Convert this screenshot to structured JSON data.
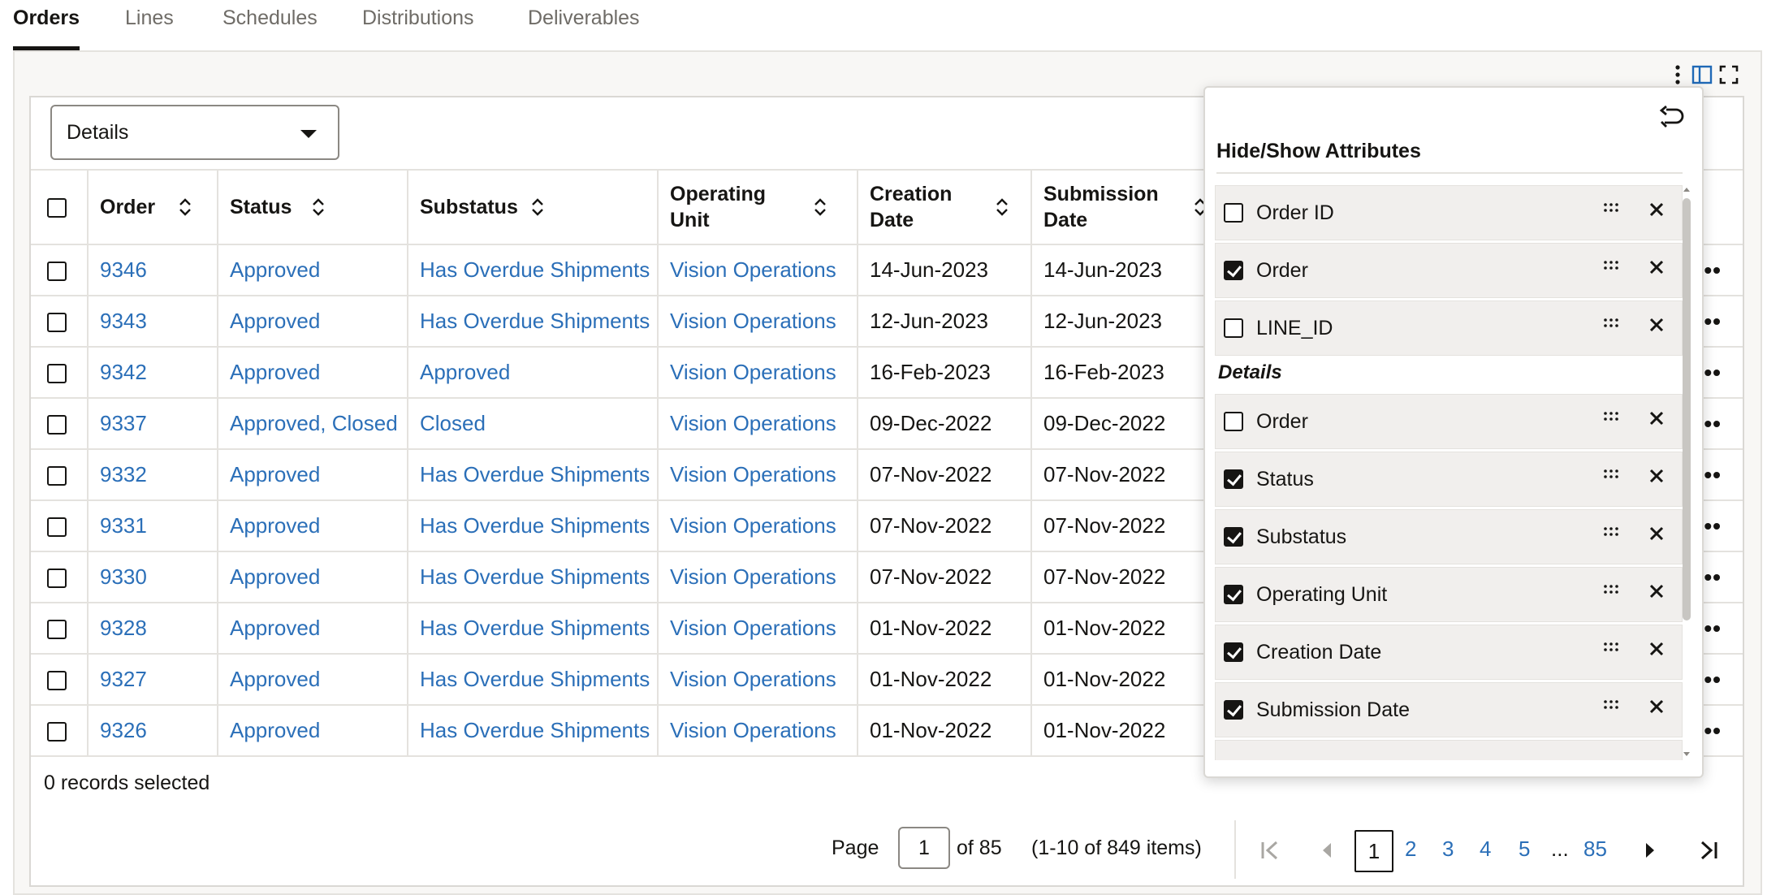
{
  "tabs": [
    {
      "label": "Orders",
      "active": true
    },
    {
      "label": "Lines",
      "active": false
    },
    {
      "label": "Schedules",
      "active": false
    },
    {
      "label": "Distributions",
      "active": false
    },
    {
      "label": "Deliverables",
      "active": false
    }
  ],
  "toolbar": {
    "icons": [
      "more-vertical-icon",
      "panel-toggle-icon",
      "fullscreen-icon"
    ]
  },
  "view_select": {
    "value": "Details"
  },
  "table": {
    "columns": [
      "Order",
      "Status",
      "Substatus",
      "Operating Unit",
      "Creation Date",
      "Submission Date"
    ],
    "rows": [
      {
        "order": "9346",
        "status": "Approved",
        "substatus": "Has Overdue Shipments",
        "unit": "Vision Operations",
        "created": "14-Jun-2023",
        "submitted": "14-Jun-2023"
      },
      {
        "order": "9343",
        "status": "Approved",
        "substatus": "Has Overdue Shipments",
        "unit": "Vision Operations",
        "created": "12-Jun-2023",
        "submitted": "12-Jun-2023"
      },
      {
        "order": "9342",
        "status": "Approved",
        "substatus": "Approved",
        "unit": "Vision Operations",
        "created": "16-Feb-2023",
        "submitted": "16-Feb-2023"
      },
      {
        "order": "9337",
        "status": "Approved, Closed",
        "substatus": "Closed",
        "unit": "Vision Operations",
        "created": "09-Dec-2022",
        "submitted": "09-Dec-2022"
      },
      {
        "order": "9332",
        "status": "Approved",
        "substatus": "Has Overdue Shipments",
        "unit": "Vision Operations",
        "created": "07-Nov-2022",
        "submitted": "07-Nov-2022"
      },
      {
        "order": "9331",
        "status": "Approved",
        "substatus": "Has Overdue Shipments",
        "unit": "Vision Operations",
        "created": "07-Nov-2022",
        "submitted": "07-Nov-2022"
      },
      {
        "order": "9330",
        "status": "Approved",
        "substatus": "Has Overdue Shipments",
        "unit": "Vision Operations",
        "created": "07-Nov-2022",
        "submitted": "07-Nov-2022"
      },
      {
        "order": "9328",
        "status": "Approved",
        "substatus": "Has Overdue Shipments",
        "unit": "Vision Operations",
        "created": "01-Nov-2022",
        "submitted": "01-Nov-2022"
      },
      {
        "order": "9327",
        "status": "Approved",
        "substatus": "Has Overdue Shipments",
        "unit": "Vision Operations",
        "created": "01-Nov-2022",
        "submitted": "01-Nov-2022"
      },
      {
        "order": "9326",
        "status": "Approved",
        "substatus": "Has Overdue Shipments",
        "unit": "Vision Operations",
        "created": "01-Nov-2022",
        "submitted": "01-Nov-2022"
      }
    ]
  },
  "footer": {
    "selected_text": "0 records selected",
    "page_label": "Page",
    "page_value": "1",
    "of_label": "of 85",
    "range_label": "(1-10 of 849 items)",
    "pages": [
      "1",
      "2",
      "3",
      "4",
      "5",
      "...",
      "85"
    ]
  },
  "attributes_popup": {
    "title": "Hide/Show Attributes",
    "section_label": "Details",
    "top_items": [
      {
        "label": "Order ID",
        "checked": false
      },
      {
        "label": "Order",
        "checked": true
      },
      {
        "label": "LINE_ID",
        "checked": false
      }
    ],
    "detail_items": [
      {
        "label": "Order",
        "checked": false
      },
      {
        "label": "Status",
        "checked": true
      },
      {
        "label": "Substatus",
        "checked": true
      },
      {
        "label": "Operating Unit",
        "checked": true
      },
      {
        "label": "Creation Date",
        "checked": true
      },
      {
        "label": "Submission Date",
        "checked": true
      }
    ]
  },
  "colors": {
    "link": "#2b6fb8",
    "accent": "#1f69b6"
  }
}
